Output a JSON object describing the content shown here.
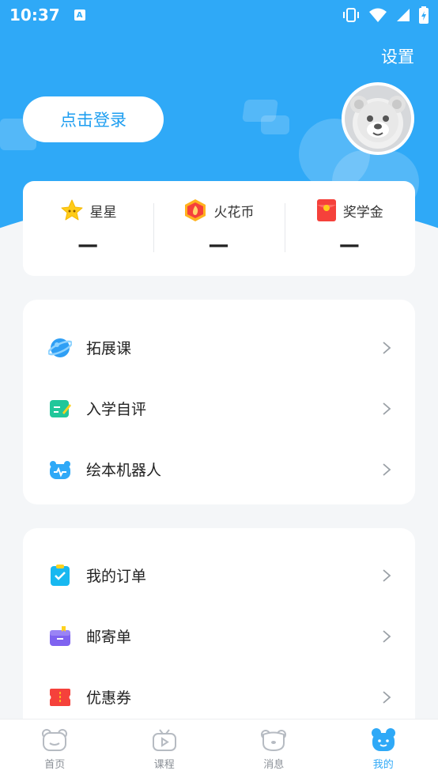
{
  "status_bar": {
    "time": "10:37",
    "notification_icon": "a-icon"
  },
  "header": {
    "settings_label": "设置",
    "login_label": "点击登录"
  },
  "stats": [
    {
      "label": "星星",
      "value": "—",
      "icon": "star-icon",
      "color": "#ffcc1a"
    },
    {
      "label": "火花币",
      "value": "—",
      "icon": "fire-coin-icon",
      "color": "#ffb21f"
    },
    {
      "label": "奖学金",
      "value": "—",
      "icon": "red-envelope-icon",
      "color": "#f5413b"
    }
  ],
  "menu_group_1": [
    {
      "label": "拓展课",
      "icon": "planet-icon",
      "color": "#2f9ff5"
    },
    {
      "label": "入学自评",
      "icon": "self-assessment-icon",
      "color": "#21c79a"
    },
    {
      "label": "绘本机器人",
      "icon": "robot-icon",
      "color": "#2fa9f7"
    }
  ],
  "menu_group_2": [
    {
      "label": "我的订单",
      "icon": "order-icon",
      "color": "#18b8f0"
    },
    {
      "label": "邮寄单",
      "icon": "mailing-box-icon",
      "color": "#7f63f0"
    },
    {
      "label": "优惠券",
      "icon": "coupon-icon",
      "color": "#f5413b"
    }
  ],
  "bottom_nav": [
    {
      "label": "首页",
      "icon": "home-bear-icon",
      "active": false
    },
    {
      "label": "课程",
      "icon": "course-tv-icon",
      "active": false
    },
    {
      "label": "消息",
      "icon": "message-bear-icon",
      "active": false
    },
    {
      "label": "我的",
      "icon": "profile-bear-icon",
      "active": true
    }
  ],
  "colors": {
    "primary": "#2fa9f7",
    "background": "#f4f6f8"
  }
}
